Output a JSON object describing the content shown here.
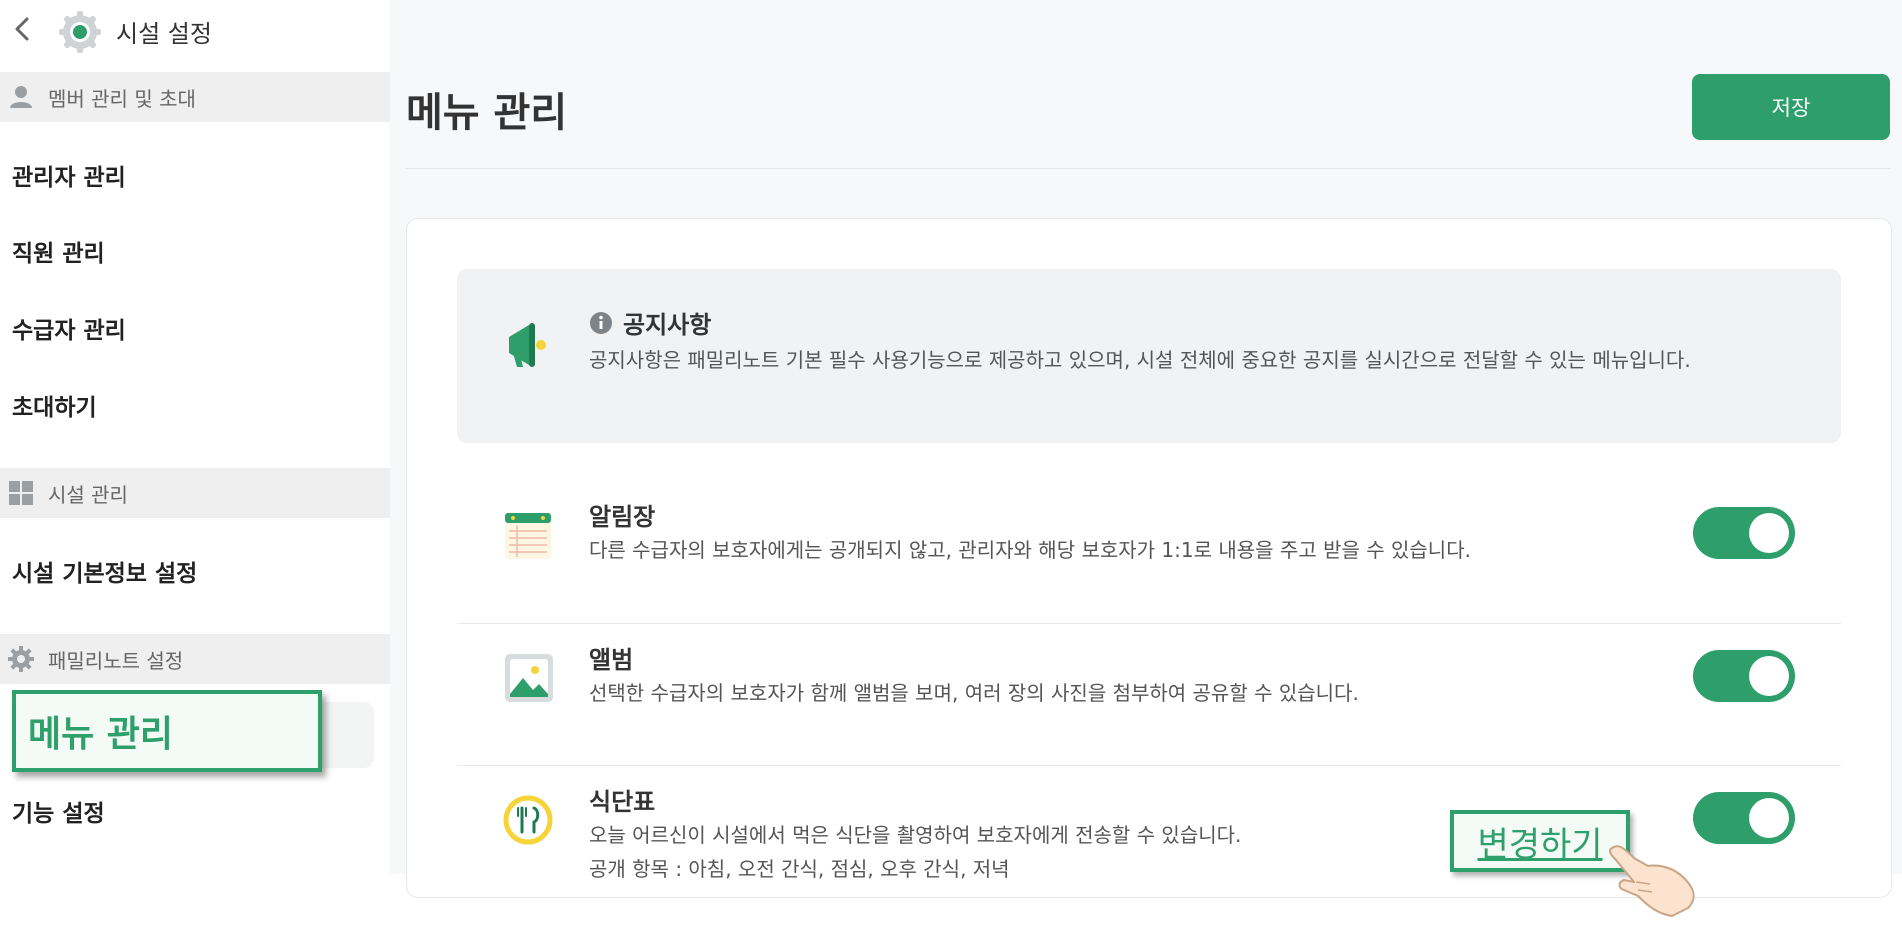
{
  "app": {
    "title": "시설 설정"
  },
  "sidebar": {
    "sections": [
      {
        "label": "멤버 관리 및 초대",
        "icon": "person-icon"
      },
      {
        "label": "시설 관리",
        "icon": "grid-icon"
      },
      {
        "label": "패밀리노트 설정",
        "icon": "gear-icon"
      }
    ],
    "items": [
      {
        "label": "관리자 관리"
      },
      {
        "label": "직원 관리"
      },
      {
        "label": "수급자 관리"
      },
      {
        "label": "초대하기"
      },
      {
        "label": "시설 기본정보 설정"
      },
      {
        "label": "메뉴 관리",
        "active": true
      },
      {
        "label": "기능 설정"
      }
    ]
  },
  "main": {
    "title": "메뉴 관리",
    "save_label": "저장",
    "notice": {
      "title": "공지사항",
      "desc": "공지사항은 패밀리노트 기본 필수 사용기능으로 제공하고 있으며, 시설 전체에 중요한 공지를 실시간으로 전달할 수 있는 메뉴입니다."
    },
    "menus": [
      {
        "title": "알림장",
        "desc": "다른 수급자의 보호자에게는 공개되지 않고, 관리자와 해당 보호자가 1:1로 내용을 주고 받을 수 있습니다.",
        "enabled": true
      },
      {
        "title": "앨범",
        "desc": "선택한 수급자의 보호자가 함께 앨범을 보며, 여러 장의 사진을 첨부하여 공유할 수 있습니다.",
        "enabled": true
      },
      {
        "title": "식단표",
        "desc": "오늘 어르신이 시설에서 먹은 식단을 촬영하여 보호자에게 전송할 수 있습니다.",
        "desc2": "공개 항목 : 아침, 오전 간식, 점심, 오후 간식, 저녁",
        "enabled": true
      }
    ]
  },
  "callout": {
    "label": "변경하기"
  },
  "colors": {
    "accent": "#2e9f6b",
    "sidebar_section_bg": "#efefef",
    "main_bg": "#f7f8f9"
  }
}
